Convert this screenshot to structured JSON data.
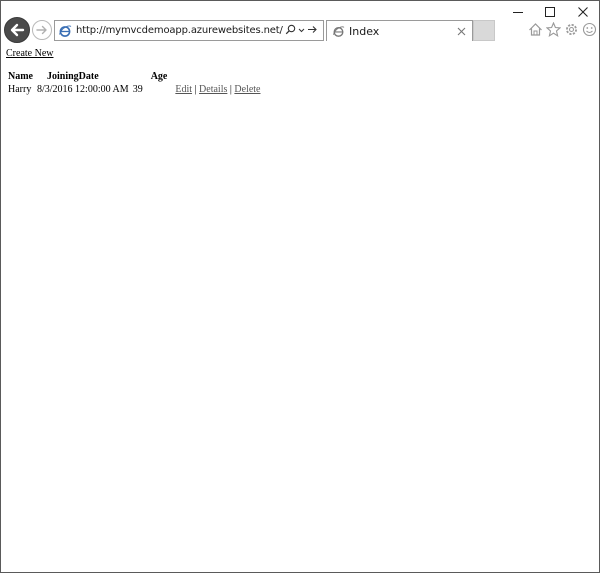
{
  "browser": {
    "address_url": "http://mymvcdemoapp.azurewebsites.net/employees",
    "tab_title": "Index"
  },
  "page": {
    "create_new_label": "Create New",
    "table": {
      "headers": [
        "Name",
        "JoiningDate",
        "Age"
      ],
      "rows": [
        {
          "name": "Harry",
          "joining_date": "8/3/2016 12:00:00 AM",
          "age": "39",
          "actions": {
            "edit": "Edit",
            "details": "Details",
            "delete": "Delete"
          }
        }
      ],
      "separator": "|"
    }
  },
  "icons": {
    "back": "back-arrow-icon",
    "forward": "forward-arrow-icon",
    "site": "ie-logo-icon",
    "search": "search-icon",
    "dropdown": "chevron-down-icon",
    "go": "go-arrow-icon",
    "tab_close": "close-icon",
    "home": "home-icon",
    "favorites": "star-icon",
    "settings": "gear-icon",
    "feedback": "smiley-icon",
    "minimize": "minimize-icon",
    "maximize": "maximize-icon",
    "close_window": "close-window-icon"
  },
  "colors": {
    "back_button": "#4b4b4b",
    "chrome_border": "#9a9a9a",
    "link_text": "#555555"
  }
}
